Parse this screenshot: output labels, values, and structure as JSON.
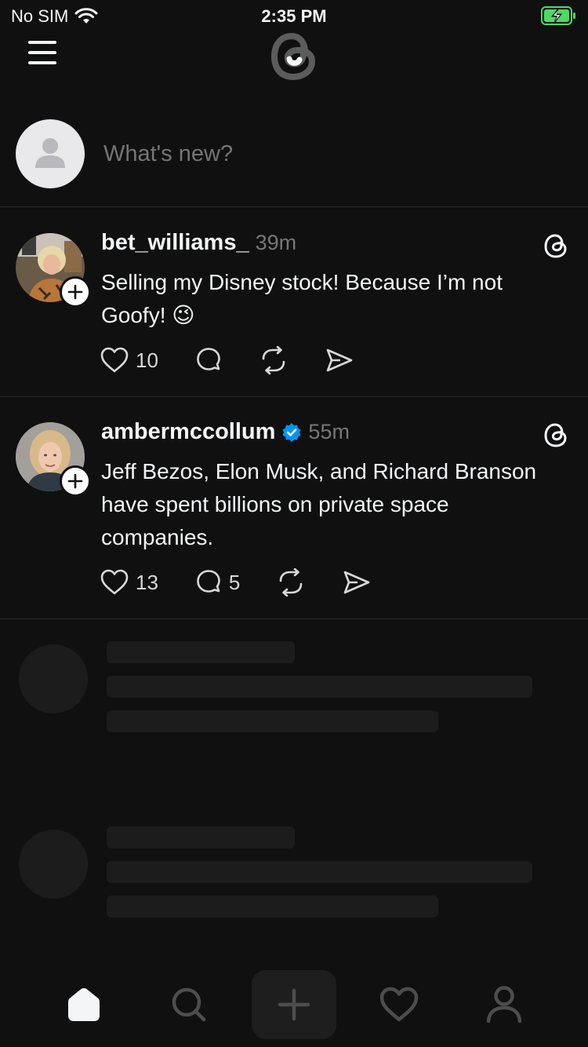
{
  "status_bar": {
    "carrier": "No SIM",
    "time": "2:35 PM"
  },
  "composer": {
    "placeholder": "What's new?"
  },
  "posts": [
    {
      "username": "bet_williams_",
      "time": "39m",
      "verified": false,
      "text": "Selling my Disney stock! Because I’m not Goofy! 😉",
      "likes": "10",
      "replies": "",
      "avatar_icon": "user-photo"
    },
    {
      "username": "ambermccollum",
      "time": "55m",
      "verified": true,
      "text": "Jeff Bezos, Elon Musk, and Richard Branson have spent billions on private space companies.",
      "likes": "13",
      "replies": "5",
      "avatar_icon": "user-photo"
    }
  ],
  "tabs": [
    {
      "name": "home",
      "icon": "home-icon",
      "active": true
    },
    {
      "name": "search",
      "icon": "search-icon",
      "active": false
    },
    {
      "name": "new-thread",
      "icon": "plus-icon",
      "active": false
    },
    {
      "name": "activity",
      "icon": "heart-icon",
      "active": false
    },
    {
      "name": "profile",
      "icon": "person-icon",
      "active": false
    }
  ],
  "colors": {
    "background": "#101010",
    "text": "#f3f5f7",
    "muted": "#777777",
    "verified": "#0095f6",
    "battery": "#4cd964",
    "skeleton": "#1c1c1d"
  }
}
